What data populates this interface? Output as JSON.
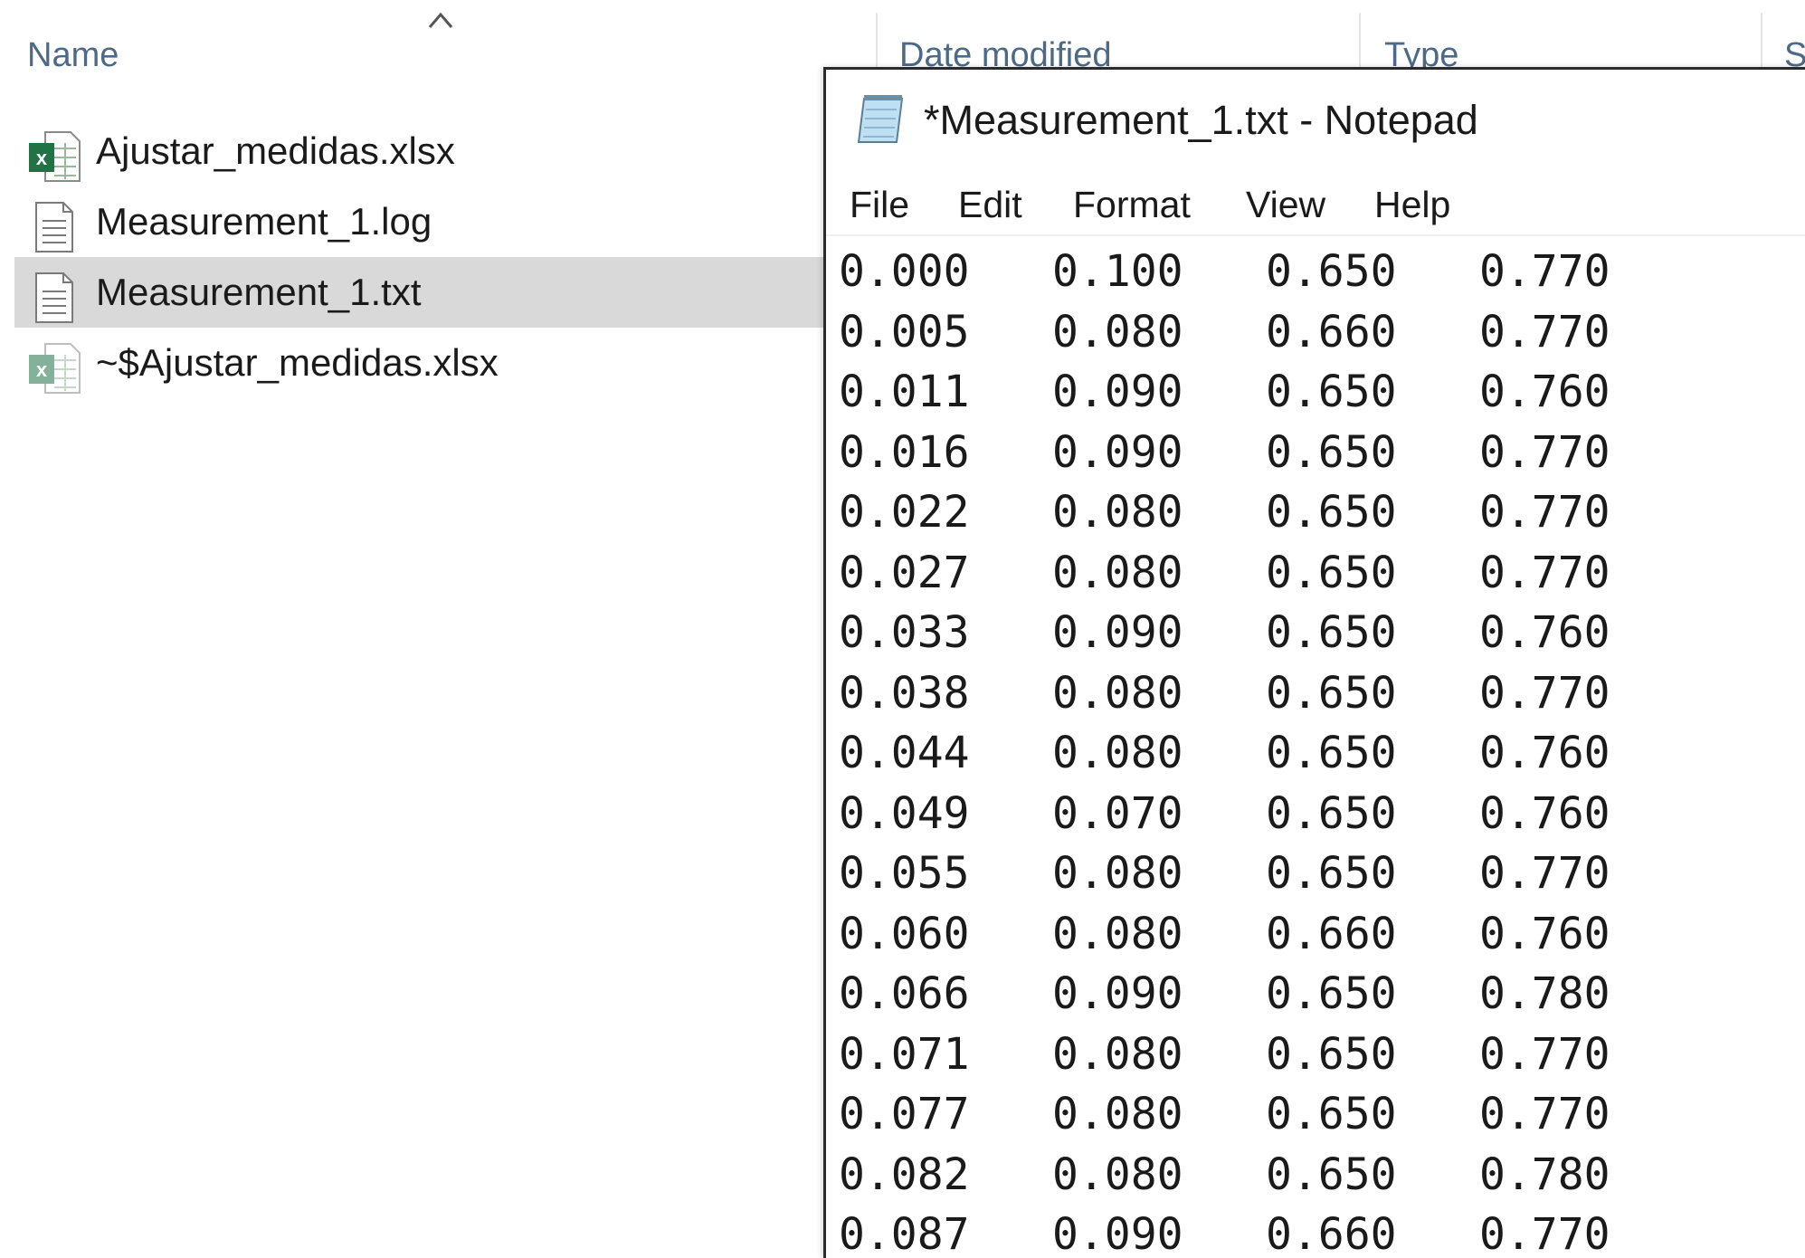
{
  "explorer": {
    "columns": {
      "name": "Name",
      "date_modified": "Date modified",
      "type": "Type",
      "size": "S"
    },
    "files": [
      {
        "name": "Ajustar_medidas.xlsx",
        "icon": "excel-file-icon",
        "selected": false
      },
      {
        "name": "Measurement_1.log",
        "icon": "text-file-icon",
        "selected": false
      },
      {
        "name": "Measurement_1.txt",
        "icon": "text-file-icon",
        "selected": true
      },
      {
        "name": "~$Ajustar_medidas.xlsx",
        "icon": "excel-file-icon",
        "selected": false
      }
    ]
  },
  "notepad": {
    "title": "*Measurement_1.txt - Notepad",
    "menu": {
      "file": "File",
      "edit": "Edit",
      "format": "Format",
      "view": "View",
      "help": "Help"
    },
    "lines": [
      [
        "0.000",
        "0.100",
        "0.650",
        "0.770"
      ],
      [
        "0.005",
        "0.080",
        "0.660",
        "0.770"
      ],
      [
        "0.011",
        "0.090",
        "0.650",
        "0.760"
      ],
      [
        "0.016",
        "0.090",
        "0.650",
        "0.770"
      ],
      [
        "0.022",
        "0.080",
        "0.650",
        "0.770"
      ],
      [
        "0.027",
        "0.080",
        "0.650",
        "0.770"
      ],
      [
        "0.033",
        "0.090",
        "0.650",
        "0.760"
      ],
      [
        "0.038",
        "0.080",
        "0.650",
        "0.770"
      ],
      [
        "0.044",
        "0.080",
        "0.650",
        "0.760"
      ],
      [
        "0.049",
        "0.070",
        "0.650",
        "0.760"
      ],
      [
        "0.055",
        "0.080",
        "0.650",
        "0.770"
      ],
      [
        "0.060",
        "0.080",
        "0.660",
        "0.760"
      ],
      [
        "0.066",
        "0.090",
        "0.650",
        "0.780"
      ],
      [
        "0.071",
        "0.080",
        "0.650",
        "0.770"
      ],
      [
        "0.077",
        "0.080",
        "0.650",
        "0.770"
      ],
      [
        "0.082",
        "0.080",
        "0.650",
        "0.780"
      ],
      [
        "0.087",
        "0.090",
        "0.660",
        "0.770"
      ]
    ]
  },
  "colors": {
    "header_text": "#4c6a88",
    "selection": "#d9d9d9",
    "excel_green": "#217346"
  }
}
